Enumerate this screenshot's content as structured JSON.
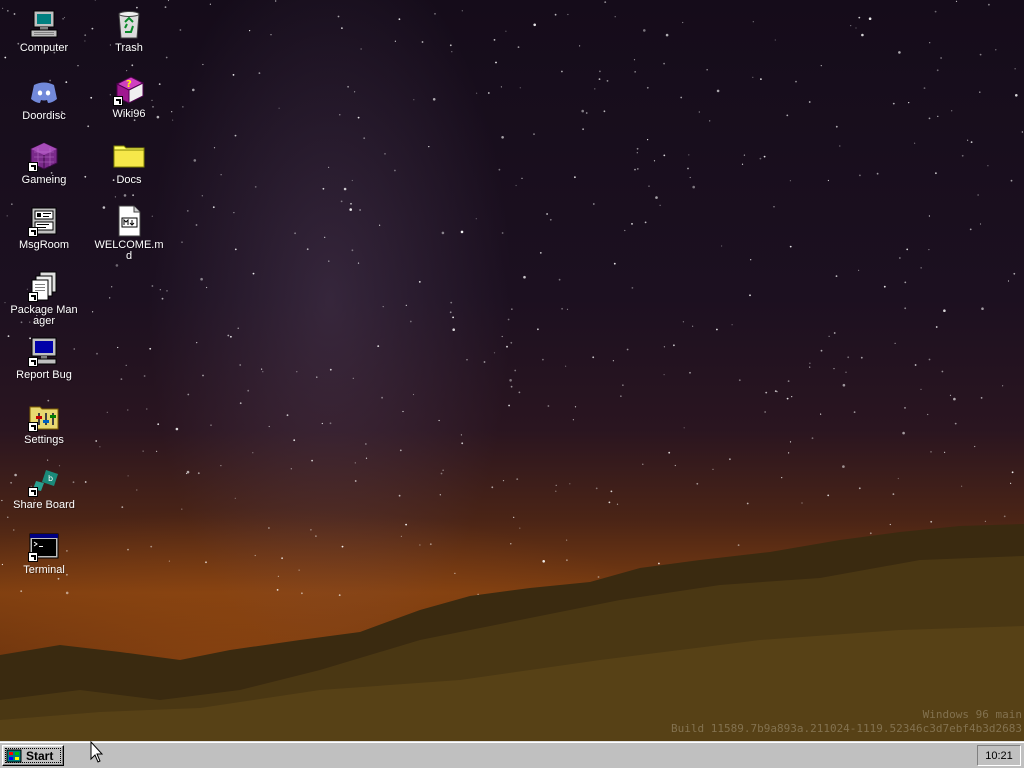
{
  "desktop": {
    "icons": [
      {
        "id": "computer",
        "label": "Computer",
        "icon": "computer-icon",
        "shortcut": false
      },
      {
        "id": "trash",
        "label": "Trash",
        "icon": "recycle-bin-icon",
        "shortcut": false
      },
      {
        "id": "doordisc",
        "label": "Doordisc",
        "icon": "discord-icon",
        "shortcut": false
      },
      {
        "id": "wiki96",
        "label": "Wiki96",
        "icon": "help-book-icon",
        "shortcut": true
      },
      {
        "id": "gameing",
        "label": "Gameing",
        "icon": "purple-cube-icon",
        "shortcut": true
      },
      {
        "id": "docs",
        "label": "Docs",
        "icon": "folder-icon",
        "shortcut": false
      },
      {
        "id": "msgroom",
        "label": "MsgRoom",
        "icon": "chat-icon",
        "shortcut": true
      },
      {
        "id": "welcome",
        "label": "WELCOME.md",
        "icon": "markdown-file-icon",
        "shortcut": false
      },
      {
        "id": "package-manager",
        "label": "Package Manager",
        "icon": "package-icon",
        "shortcut": true
      },
      {
        "id": "report-bug",
        "label": "Report Bug",
        "icon": "monitor-icon",
        "shortcut": true
      },
      {
        "id": "settings",
        "label": "Settings",
        "icon": "settings-folder-icon",
        "shortcut": true
      },
      {
        "id": "share-board",
        "label": "Share Board",
        "icon": "share-board-icon",
        "shortcut": true
      },
      {
        "id": "terminal",
        "label": "Terminal",
        "icon": "terminal-icon",
        "shortcut": true
      }
    ]
  },
  "watermark": {
    "line1": "Windows 96 main",
    "line2": "Build 11589.7b9a893a.211024-1119.52346c3d7ebf4b3d2683"
  },
  "taskbar": {
    "start_label": "Start",
    "clock": "10:21"
  },
  "colors": {
    "taskbar_bg": "#c0c0c0",
    "icon_label": "#ffffff",
    "folder_yellow": "#ffff66",
    "discord_blurple": "#7289da"
  }
}
